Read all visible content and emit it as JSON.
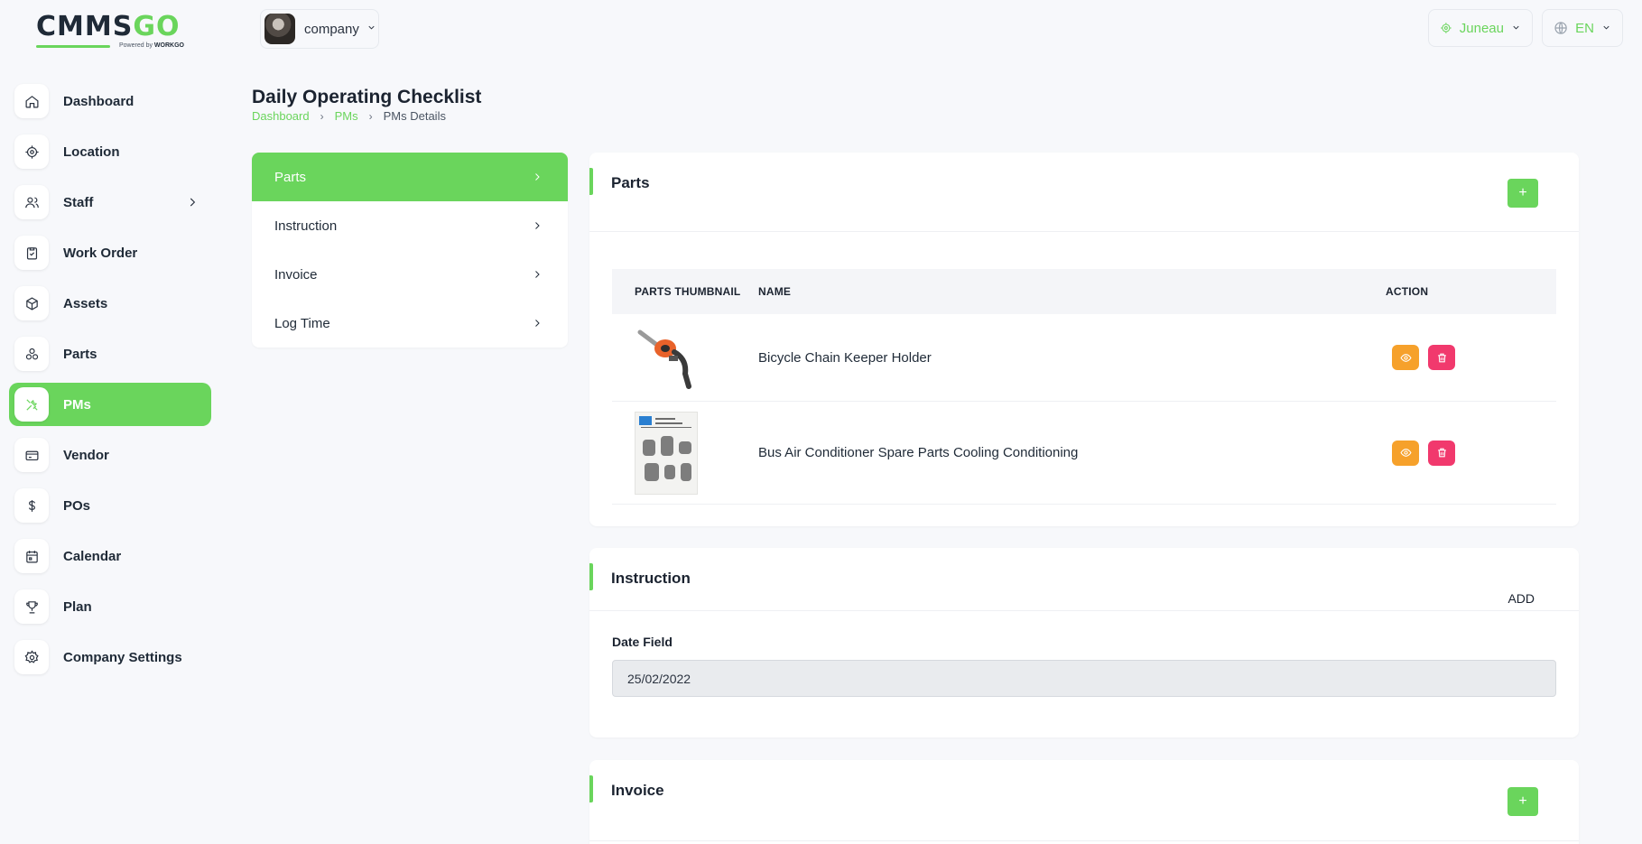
{
  "brand": {
    "logo_main": "CMMS",
    "logo_accent": "GO",
    "powered_prefix": "Powered by",
    "powered_name": "WORKGO"
  },
  "sidebar": {
    "items": [
      {
        "label": "Dashboard",
        "icon": "home-icon",
        "active": false
      },
      {
        "label": "Location",
        "icon": "location-icon",
        "active": false
      },
      {
        "label": "Staff",
        "icon": "users-icon",
        "active": false,
        "has_submenu": true
      },
      {
        "label": "Work Order",
        "icon": "clipboard-icon",
        "active": false
      },
      {
        "label": "Assets",
        "icon": "box-icon",
        "active": false
      },
      {
        "label": "Parts",
        "icon": "parts-icon",
        "active": false
      },
      {
        "label": "PMs",
        "icon": "tools-icon",
        "active": true
      },
      {
        "label": "Vendor",
        "icon": "card-icon",
        "active": false
      },
      {
        "label": "POs",
        "icon": "dollar-icon",
        "active": false
      },
      {
        "label": "Calendar",
        "icon": "calendar-icon",
        "active": false
      },
      {
        "label": "Plan",
        "icon": "trophy-icon",
        "active": false
      },
      {
        "label": "Company Settings",
        "icon": "gear-icon",
        "active": false
      }
    ]
  },
  "topbar": {
    "company_label": "company",
    "location_label": "Juneau",
    "language_label": "EN"
  },
  "page": {
    "title": "Daily Operating Checklist",
    "breadcrumb": [
      "Dashboard",
      "PMs",
      "PMs Details"
    ]
  },
  "tabs": [
    {
      "label": "Parts",
      "active": true
    },
    {
      "label": "Instruction",
      "active": false
    },
    {
      "label": "Invoice",
      "active": false
    },
    {
      "label": "Log Time",
      "active": false
    }
  ],
  "parts_card": {
    "title": "Parts",
    "add_symbol": "+",
    "columns": [
      "PARTS THUMBNAIL",
      "NAME",
      "ACTION"
    ],
    "rows": [
      {
        "name": "Bicycle Chain Keeper Holder"
      },
      {
        "name": "Bus Air Conditioner Spare Parts Cooling Conditioning"
      }
    ]
  },
  "instruction_card": {
    "title": "Instruction",
    "add_label": "ADD",
    "field_label": "Date Field",
    "field_value": "25/02/2022"
  },
  "invoice_card": {
    "title": "Invoice",
    "add_symbol": "+"
  },
  "colors": {
    "accent": "#6ad55c",
    "view": "#f6a12b",
    "delete": "#f1396d"
  }
}
